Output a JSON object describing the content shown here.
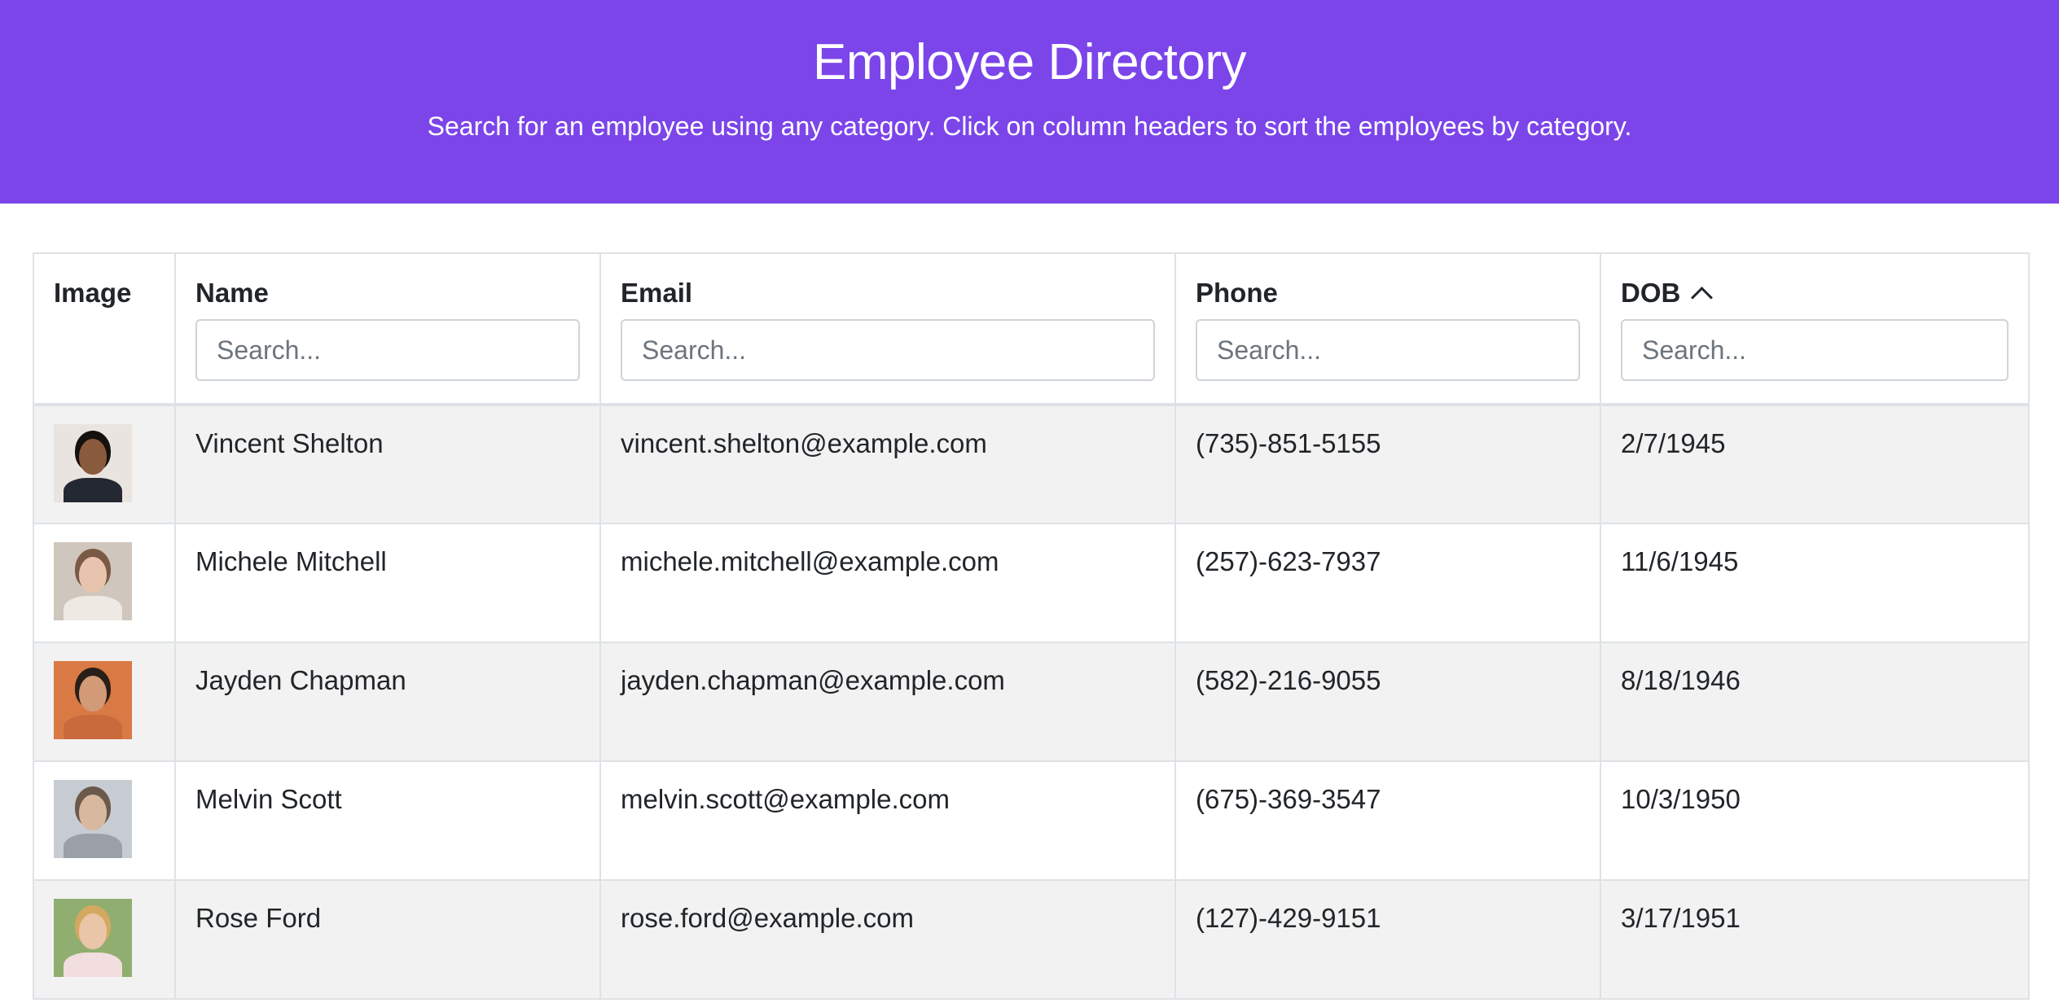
{
  "header": {
    "title": "Employee Directory",
    "subtitle": "Search for an employee using any category. Click on column headers to sort the employees by category."
  },
  "table": {
    "columns": {
      "image": "Image",
      "name": "Name",
      "email": "Email",
      "phone": "Phone",
      "dob": "DOB"
    },
    "sorted_by": "DOB",
    "sort_direction": "ascending",
    "search_placeholder": "Search...",
    "rows": [
      {
        "name": "Vincent Shelton",
        "email": "vincent.shelton@example.com",
        "phone": "(735)-851-5155",
        "dob": "2/7/1945",
        "avatar": {
          "bg": "#e9e4df",
          "hair": "#15110e",
          "face": "#8a5a3c",
          "body": "#232833"
        }
      },
      {
        "name": "Michele Mitchell",
        "email": "michele.mitchell@example.com",
        "phone": "(257)-623-7937",
        "dob": "11/6/1945",
        "avatar": {
          "bg": "#cfc6bd",
          "hair": "#7a5a44",
          "face": "#e8c4ae",
          "body": "#efe9e4"
        }
      },
      {
        "name": "Jayden Chapman",
        "email": "jayden.chapman@example.com",
        "phone": "(582)-216-9055",
        "dob": "8/18/1946",
        "avatar": {
          "bg": "#d97a45",
          "hair": "#2a1e18",
          "face": "#d39a78",
          "body": "#c96a3c"
        }
      },
      {
        "name": "Melvin Scott",
        "email": "melvin.scott@example.com",
        "phone": "(675)-369-3547",
        "dob": "10/3/1950",
        "avatar": {
          "bg": "#c7ccd2",
          "hair": "#6b5a4c",
          "face": "#d9b8a0",
          "body": "#9aa0a6"
        }
      },
      {
        "name": "Rose Ford",
        "email": "rose.ford@example.com",
        "phone": "(127)-429-9151",
        "dob": "3/17/1951",
        "avatar": {
          "bg": "#8fae6f",
          "hair": "#d4a861",
          "face": "#eac6a8",
          "body": "#f2dede"
        }
      }
    ]
  }
}
